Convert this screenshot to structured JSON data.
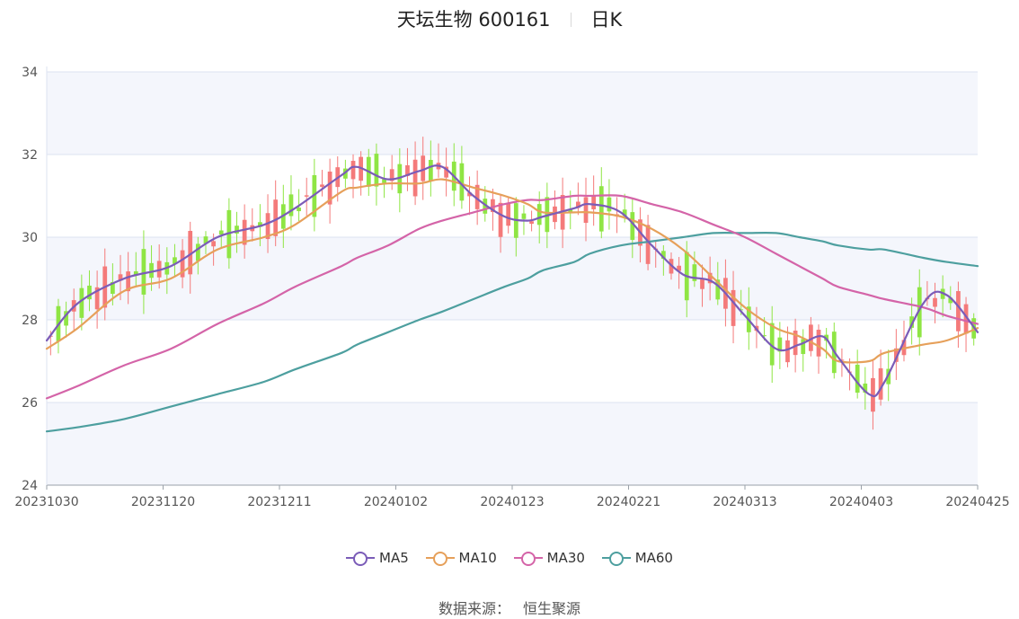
{
  "title": {
    "name": "天坛生物 600161",
    "period": "日K"
  },
  "source": {
    "label": "数据来源：",
    "value": "恒生聚源"
  },
  "chart_data": {
    "type": "line",
    "title": "天坛生物 600161",
    "xlabel": "",
    "ylabel": "",
    "ylim": [
      24,
      34
    ],
    "yticks": [
      24,
      26,
      28,
      30,
      32,
      34
    ],
    "grid": true,
    "legend_placement": "bottom",
    "x_tick_labels": [
      "20231030",
      "20231120",
      "20231211",
      "20240102",
      "20240123",
      "20240221",
      "20240313",
      "20240403",
      "20240425"
    ],
    "n_trading_days": 120,
    "colors": {
      "up": "#f47a7a",
      "down": "#8fe544",
      "MA5": "#7b5cb8",
      "MA10": "#e6a05a",
      "MA30": "#d464a8",
      "MA60": "#4d9f9f",
      "band": "#f4f6fc",
      "gridline": "#dde3f0",
      "axis": "#9aa0a8"
    },
    "series": [
      {
        "name": "MA5",
        "keypoints": [
          [
            0,
            27.5
          ],
          [
            4,
            28.4
          ],
          [
            10,
            29.0
          ],
          [
            16,
            29.3
          ],
          [
            22,
            30.0
          ],
          [
            28,
            30.3
          ],
          [
            32,
            30.7
          ],
          [
            38,
            31.5
          ],
          [
            40,
            31.7
          ],
          [
            44,
            31.4
          ],
          [
            48,
            31.6
          ],
          [
            51,
            31.7
          ],
          [
            55,
            31.0
          ],
          [
            59,
            30.5
          ],
          [
            62,
            30.4
          ],
          [
            64,
            30.5
          ],
          [
            68,
            30.7
          ],
          [
            70,
            30.8
          ],
          [
            74,
            30.6
          ],
          [
            78,
            29.8
          ],
          [
            82,
            29.1
          ],
          [
            86,
            28.9
          ],
          [
            90,
            28.1
          ],
          [
            94,
            27.3
          ],
          [
            97,
            27.4
          ],
          [
            100,
            27.6
          ],
          [
            102,
            27.1
          ],
          [
            106,
            26.2
          ],
          [
            108,
            26.5
          ],
          [
            113,
            28.4
          ],
          [
            116,
            28.6
          ],
          [
            120,
            27.7
          ]
        ]
      },
      {
        "name": "MA10",
        "keypoints": [
          [
            0,
            27.3
          ],
          [
            4,
            27.8
          ],
          [
            10,
            28.7
          ],
          [
            16,
            29.0
          ],
          [
            22,
            29.7
          ],
          [
            28,
            30.0
          ],
          [
            32,
            30.3
          ],
          [
            38,
            31.1
          ],
          [
            40,
            31.2
          ],
          [
            44,
            31.3
          ],
          [
            48,
            31.3
          ],
          [
            51,
            31.4
          ],
          [
            55,
            31.2
          ],
          [
            59,
            31.0
          ],
          [
            62,
            30.8
          ],
          [
            64,
            30.6
          ],
          [
            68,
            30.6
          ],
          [
            70,
            30.6
          ],
          [
            74,
            30.5
          ],
          [
            78,
            30.2
          ],
          [
            82,
            29.7
          ],
          [
            86,
            29.0
          ],
          [
            90,
            28.3
          ],
          [
            94,
            27.8
          ],
          [
            97,
            27.6
          ],
          [
            100,
            27.3
          ],
          [
            102,
            27.0
          ],
          [
            106,
            27.0
          ],
          [
            108,
            27.2
          ],
          [
            113,
            27.4
          ],
          [
            116,
            27.5
          ],
          [
            120,
            27.8
          ]
        ]
      },
      {
        "name": "MA30",
        "keypoints": [
          [
            0,
            26.1
          ],
          [
            4,
            26.4
          ],
          [
            10,
            26.9
          ],
          [
            16,
            27.3
          ],
          [
            22,
            27.9
          ],
          [
            28,
            28.4
          ],
          [
            32,
            28.8
          ],
          [
            38,
            29.3
          ],
          [
            40,
            29.5
          ],
          [
            44,
            29.8
          ],
          [
            48,
            30.2
          ],
          [
            51,
            30.4
          ],
          [
            55,
            30.6
          ],
          [
            59,
            30.8
          ],
          [
            62,
            30.9
          ],
          [
            64,
            30.9
          ],
          [
            68,
            31.0
          ],
          [
            70,
            31.0
          ],
          [
            74,
            31.0
          ],
          [
            78,
            30.8
          ],
          [
            82,
            30.6
          ],
          [
            86,
            30.3
          ],
          [
            90,
            30.0
          ],
          [
            94,
            29.6
          ],
          [
            97,
            29.3
          ],
          [
            100,
            29.0
          ],
          [
            102,
            28.8
          ],
          [
            106,
            28.6
          ],
          [
            108,
            28.5
          ],
          [
            113,
            28.3
          ],
          [
            116,
            28.1
          ],
          [
            120,
            27.9
          ]
        ]
      },
      {
        "name": "MA60",
        "keypoints": [
          [
            0,
            25.3
          ],
          [
            4,
            25.4
          ],
          [
            10,
            25.6
          ],
          [
            16,
            25.9
          ],
          [
            22,
            26.2
          ],
          [
            28,
            26.5
          ],
          [
            32,
            26.8
          ],
          [
            38,
            27.2
          ],
          [
            40,
            27.4
          ],
          [
            44,
            27.7
          ],
          [
            48,
            28.0
          ],
          [
            51,
            28.2
          ],
          [
            55,
            28.5
          ],
          [
            59,
            28.8
          ],
          [
            62,
            29.0
          ],
          [
            64,
            29.2
          ],
          [
            68,
            29.4
          ],
          [
            70,
            29.6
          ],
          [
            74,
            29.8
          ],
          [
            78,
            29.9
          ],
          [
            82,
            30.0
          ],
          [
            86,
            30.1
          ],
          [
            90,
            30.1
          ],
          [
            94,
            30.1
          ],
          [
            97,
            30.0
          ],
          [
            100,
            29.9
          ],
          [
            102,
            29.8
          ],
          [
            106,
            29.7
          ],
          [
            108,
            29.7
          ],
          [
            113,
            29.5
          ],
          [
            116,
            29.4
          ],
          [
            120,
            29.3
          ]
        ]
      }
    ]
  }
}
